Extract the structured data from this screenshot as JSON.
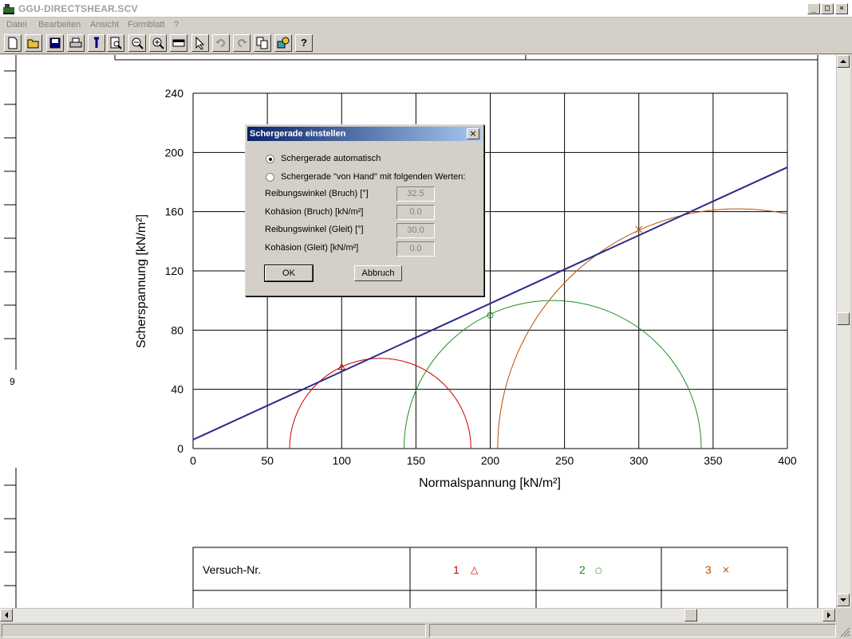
{
  "window": {
    "title": "GGU-DIRECTSHEAR.SCV",
    "minimize": "_",
    "maximize": "□",
    "close": "×"
  },
  "menu": [
    "Datei",
    "Bearbeiten",
    "Ansicht",
    "Formblatt",
    "?"
  ],
  "toolbar": {
    "help_label": "?"
  },
  "page": {
    "side_number": "9"
  },
  "chart_data": {
    "type": "scatter",
    "xlabel": "Normalspannung [kN/m²]",
    "ylabel": "Scherspannung [kN/m²]",
    "xlim": [
      0,
      400
    ],
    "ylim": [
      0,
      240
    ],
    "xticks": [
      0,
      50,
      100,
      150,
      200,
      250,
      300,
      350,
      400
    ],
    "yticks": [
      0,
      40,
      80,
      120,
      160,
      200,
      240
    ],
    "grid": true,
    "failure_line": {
      "x": [
        0,
        400
      ],
      "y": [
        6,
        190
      ]
    },
    "circles": [
      {
        "test": "1",
        "center": 126,
        "radius": 61,
        "color": "#cc0000"
      },
      {
        "test": "2",
        "center": 242,
        "radius": 100,
        "color": "#228b22"
      },
      {
        "test": "3",
        "center": 367,
        "radius": 162,
        "color": "#b84f00"
      }
    ],
    "points": [
      {
        "test": "1",
        "x": 100,
        "y": 55,
        "marker": "triangle",
        "color": "#cc0000"
      },
      {
        "test": "2",
        "x": 200,
        "y": 90,
        "marker": "circle",
        "color": "#228b22"
      },
      {
        "test": "3",
        "x": 300,
        "y": 148,
        "marker": "x",
        "color": "#b84f00"
      }
    ]
  },
  "table": {
    "header": "Versuch-Nr.",
    "tests": [
      {
        "no": "1",
        "symbol": "△",
        "color": "#cc0000"
      },
      {
        "no": "2",
        "symbol": "○",
        "color": "#228b22"
      },
      {
        "no": "3",
        "symbol": "×",
        "color": "#b84f00"
      }
    ]
  },
  "dialog": {
    "title": "Schergerade einstellen",
    "close": "×",
    "options": [
      {
        "label": "Schergerade automatisch",
        "selected": true
      },
      {
        "label": "Schergerade \"von Hand\" mit folgenden Werten:",
        "selected": false
      }
    ],
    "fields": [
      {
        "label": "Reibungswinkel (Bruch) [°]",
        "value": "32.5"
      },
      {
        "label": "Kohäsion (Bruch) [kN/m²]",
        "value": "0.0"
      },
      {
        "label": "Reibungswinkel (Gleit) [°]",
        "value": "30.0"
      },
      {
        "label": "Kohäsion (Gleit) [kN/m²]",
        "value": "0.0"
      }
    ],
    "ok": "OK",
    "cancel": "Abbruch"
  }
}
